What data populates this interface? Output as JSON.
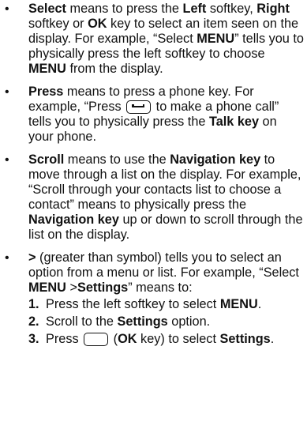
{
  "bullets": [
    {
      "symbol": "•",
      "text": [
        {
          "b": "Select"
        },
        " means to press the ",
        {
          "b": "Left"
        },
        " softkey, ",
        {
          "b": "Right"
        },
        " softkey or ",
        {
          "b": "OK"
        },
        " key to select an item seen on the display. For example, “Select ",
        {
          "b": "MENU"
        },
        "” tells you to physically press the left softkey to choose ",
        {
          "b": "MENU"
        },
        " from the display."
      ]
    },
    {
      "symbol": "•",
      "text": [
        {
          "b": "Press"
        },
        " means to press a phone key. For example, “Press ",
        {
          "icon": "talk-key-icon"
        },
        " to make a phone call” tells you to physically press the ",
        {
          "b": "Talk key"
        },
        " on your phone."
      ]
    },
    {
      "symbol": "•",
      "text": [
        {
          "b": "Scroll"
        },
        " means to use the ",
        {
          "b": "Navigation key"
        },
        " to move through a list on the display. For example, “Scroll through your contacts list to choose a contact” means to physically press the ",
        {
          "b": "Navigation key"
        },
        " up or down to scroll through the list on the display."
      ]
    },
    {
      "symbol": "•",
      "text": [
        {
          "b": ">"
        },
        " (greater than symbol) tells you to select an option from a menu or list. For example, “Select ",
        {
          "b": "MENU"
        },
        " >",
        {
          "b": "Settings"
        },
        "” means to:"
      ],
      "steps": [
        {
          "num": "1.",
          "text": [
            "Press the left softkey to select ",
            {
              "b": "MENU"
            },
            "."
          ]
        },
        {
          "num": "2.",
          "text": [
            "Scroll to the ",
            {
              "b": "Settings"
            },
            " option."
          ]
        },
        {
          "num": "3.",
          "text": [
            "Press ",
            {
              "icon": "ok-key-icon"
            },
            " (",
            {
              "b": "OK"
            },
            " key) to select ",
            {
              "b": "Settings"
            },
            "."
          ]
        }
      ]
    }
  ]
}
